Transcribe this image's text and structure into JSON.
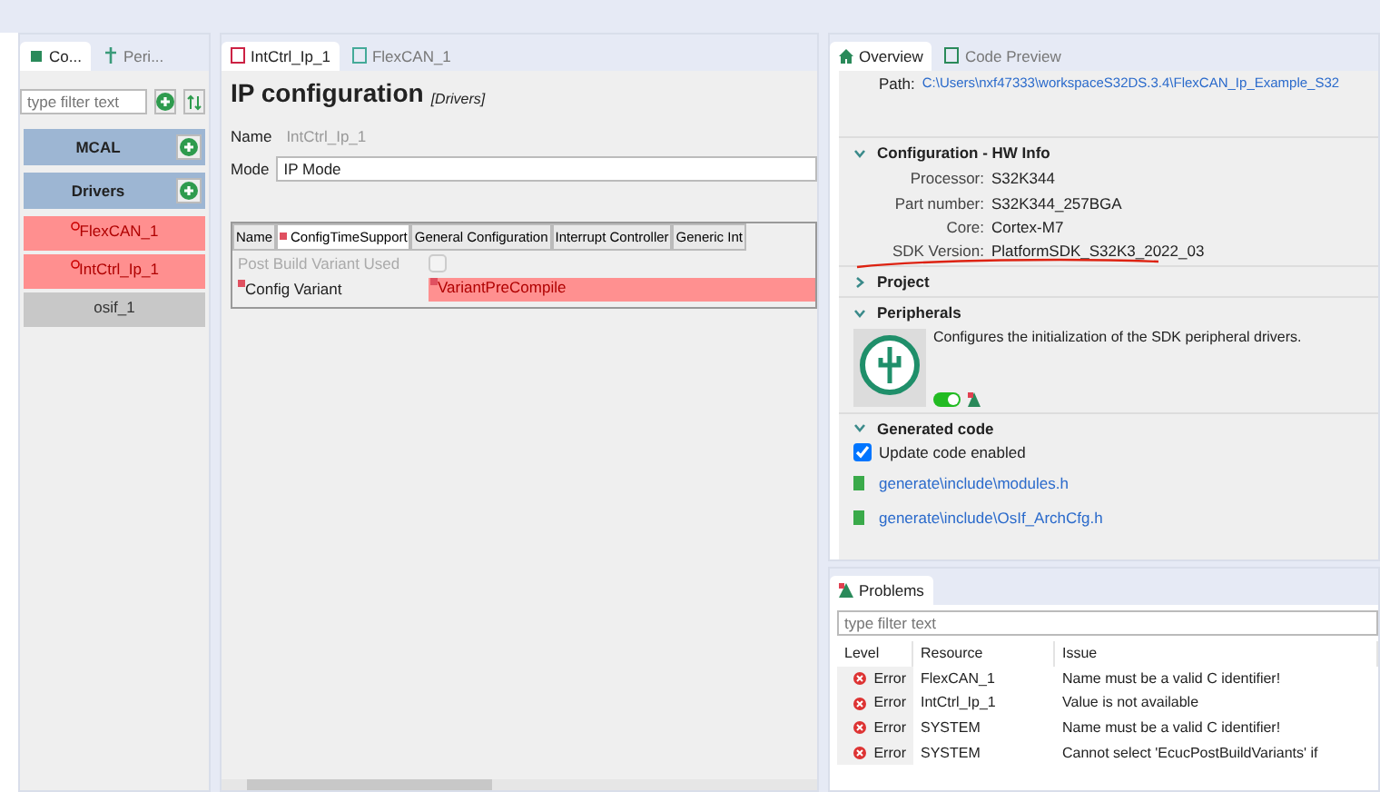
{
  "left_panel": {
    "tabs": [
      {
        "label": "Co...",
        "selected": true
      },
      {
        "label": "Peri...",
        "selected": false
      }
    ],
    "filter": {
      "placeholder": "type filter text"
    },
    "components": [
      {
        "label": "MCAL",
        "kind": "category"
      },
      {
        "label": "Drivers",
        "kind": "category"
      },
      {
        "label": "FlexCAN_1",
        "kind": "component",
        "error": true
      },
      {
        "label": "IntCtrl_Ip_1",
        "kind": "component",
        "error": true
      },
      {
        "label": "osif_1",
        "kind": "component",
        "error": false
      }
    ]
  },
  "editor": {
    "tabs": [
      {
        "label": "IntCtrl_Ip_1",
        "selected": true
      },
      {
        "label": "FlexCAN_1",
        "selected": false
      }
    ],
    "title": "IP configuration",
    "subtitle": "[Drivers]",
    "fields": [
      {
        "label": "Name",
        "value": "IntCtrl_Ip_1",
        "disabled": true
      },
      {
        "label": "Mode",
        "value": "IP Mode",
        "disabled": false
      }
    ],
    "config_tabs": [
      {
        "label": "Name",
        "required": false,
        "selected": false
      },
      {
        "label": "ConfigTimeSupport",
        "required": true,
        "selected": true
      },
      {
        "label": "General Configuration",
        "required": false,
        "selected": false
      },
      {
        "label": "Interrupt Controller",
        "required": false,
        "selected": false
      },
      {
        "label": "Generic Int",
        "required": false,
        "selected": false
      }
    ],
    "rows": [
      {
        "kind": "checkbox",
        "label": "Post Build Variant Used",
        "disabled": true,
        "checked": false,
        "required": false
      },
      {
        "kind": "select",
        "label": "Config Variant",
        "value": "VariantPreCompile",
        "required": true,
        "error": true,
        "disabled": false
      }
    ]
  },
  "overview": {
    "tabs": [
      {
        "label": "Overview",
        "selected": true
      },
      {
        "label": "Code Preview",
        "selected": false
      }
    ],
    "path_label": "Path:",
    "path": "C:\\Users\\nxf47333\\workspaceS32DS.3.4\\FlexCAN_Ip_Example_S32",
    "sections": [
      {
        "kind": "info",
        "title": "Configuration - HW Info",
        "expanded": true,
        "fields": [
          {
            "label": "Processor:",
            "value": "S32K344"
          },
          {
            "label": "Part number:",
            "value": "S32K344_257BGA"
          },
          {
            "label": "Core:",
            "value": "Cortex-M7"
          },
          {
            "label": "SDK Version:",
            "value": "PlatformSDK_S32K3_2022_03"
          }
        ]
      },
      {
        "kind": "plain",
        "title": "Project",
        "expanded": false
      },
      {
        "kind": "peripherals",
        "title": "Peripherals",
        "expanded": true,
        "description": "Configures the initialization of the SDK peripheral drivers.",
        "enabled": true
      },
      {
        "kind": "generated",
        "title": "Generated code",
        "expanded": true,
        "update": {
          "label": "Update code enabled",
          "checked": true
        },
        "files": [
          "generate\\include\\modules.h",
          "generate\\include\\OsIf_ArchCfg.h"
        ]
      }
    ]
  },
  "problems": {
    "title": "Problems",
    "filter": {
      "placeholder": "type filter text"
    },
    "columns": [
      "Level",
      "Resource",
      "Issue"
    ],
    "rows": [
      {
        "level": "Error",
        "resource": "FlexCAN_1",
        "issue": "Name must be a valid C identifier!"
      },
      {
        "level": "Error",
        "resource": "IntCtrl_Ip_1",
        "issue": "Value is not available"
      },
      {
        "level": "Error",
        "resource": "SYSTEM",
        "issue": "Name must be a valid C identifier!"
      },
      {
        "level": "Error",
        "resource": "SYSTEM",
        "issue": "Cannot select 'EcucPostBuildVariants' if"
      }
    ]
  }
}
